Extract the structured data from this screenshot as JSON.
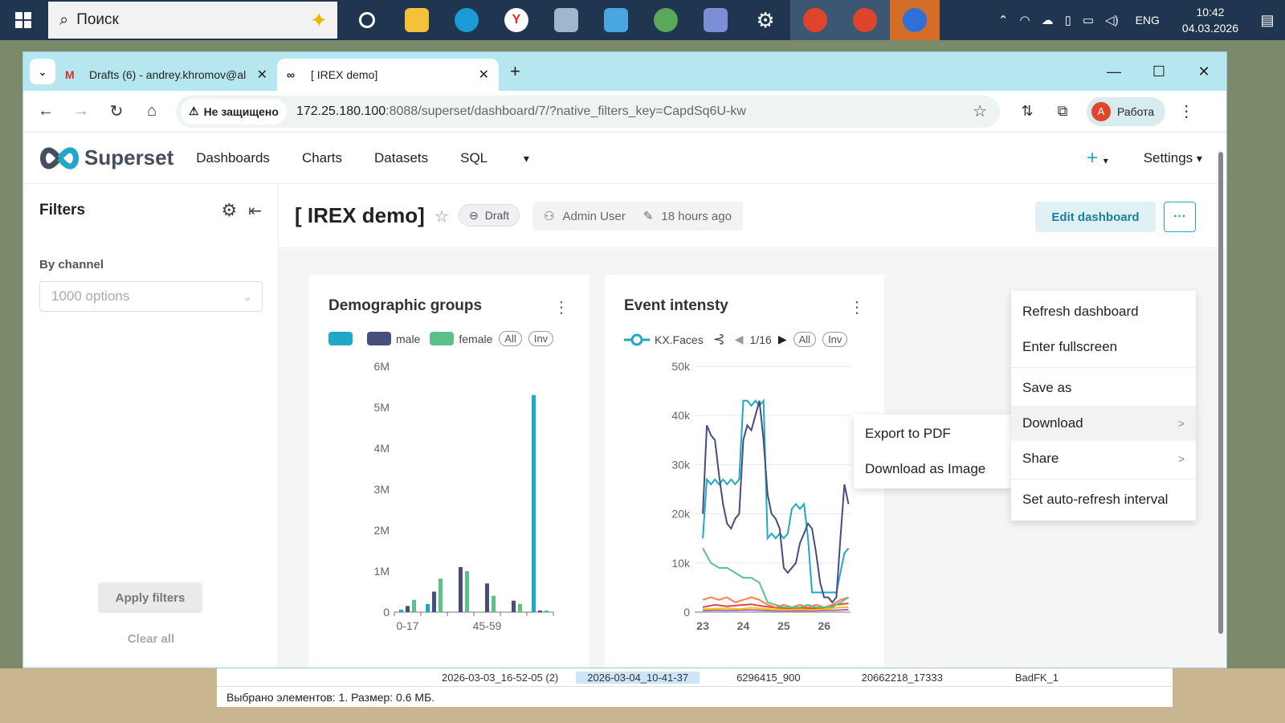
{
  "taskbar": {
    "search_placeholder": "Поиск",
    "lang": "ENG",
    "time": "10:42",
    "date": "04.03.2026"
  },
  "explorer": {
    "row_cells": [
      "2026-03-03_16-52-05 (2)",
      "2026-03-04_10-41-37",
      "6296415_900",
      "20662218_17333",
      "BadFK_1"
    ],
    "status": "Выбрано элементов: 1. Размер: 0.6 МБ."
  },
  "browser": {
    "tabs": [
      {
        "title": "Drafts (6) - andrey.khromov@al"
      },
      {
        "title": "[ IREX demo]"
      }
    ],
    "security_label": "Не защищено",
    "url_host": "172.25.180.100",
    "url_rest": ":8088/superset/dashboard/7/?native_filters_key=CapdSq6U-kw",
    "profile_initial": "А",
    "profile_label": "Работа"
  },
  "superset": {
    "brand": "Superset",
    "nav": [
      "Dashboards",
      "Charts",
      "Datasets",
      "SQL"
    ],
    "settings_label": "Settings"
  },
  "sidebar": {
    "title": "Filters",
    "filter_label": "By channel",
    "select_placeholder": "1000 options",
    "apply_label": "Apply filters",
    "clear_label": "Clear all"
  },
  "dashboard": {
    "title": "[ IREX demo]",
    "status": "Draft",
    "owner": "Admin User",
    "modified": "18 hours ago",
    "edit_label": "Edit dashboard",
    "more_label": "···"
  },
  "menu": {
    "items": [
      "Refresh dashboard",
      "Enter fullscreen",
      "Save as",
      "Download",
      "Share",
      "Set auto-refresh interval"
    ],
    "submenu": [
      "Export to PDF",
      "Download as Image"
    ]
  },
  "chart_data": [
    {
      "type": "bar",
      "title": "Demographic groups",
      "legend_items": [
        "male",
        "female"
      ],
      "legend_controls": [
        "All",
        "Inv"
      ],
      "tick_labels_x": [
        "0-17",
        "45-59"
      ],
      "ylim": [
        0,
        6000000
      ],
      "ytick_labels": [
        "0",
        "1M",
        "2M",
        "3M",
        "4M",
        "5M",
        "6M"
      ],
      "ytick_values": [
        0,
        1000000,
        2000000,
        3000000,
        4000000,
        5000000,
        6000000
      ],
      "group_count": 6,
      "series": [
        {
          "name": "",
          "color": "#1fa8c9",
          "values": [
            60000,
            200000,
            0,
            0,
            0,
            5300000
          ]
        },
        {
          "name": "male",
          "color": "#454e7c",
          "values": [
            150000,
            500000,
            1100000,
            700000,
            280000,
            40000
          ]
        },
        {
          "name": "female",
          "color": "#5ac189",
          "values": [
            300000,
            820000,
            1000000,
            400000,
            200000,
            40000
          ]
        }
      ]
    },
    {
      "type": "line",
      "title": "Event intensty",
      "legend_series": "KX.Faces",
      "legend_page": "1/16",
      "legend_controls": [
        "All",
        "Inv"
      ],
      "xlim": [
        22.8,
        26.65
      ],
      "ylim": [
        0,
        50000
      ],
      "xtick_labels": [
        "23",
        "24",
        "25",
        "26"
      ],
      "xtick_values": [
        23,
        24,
        25,
        26
      ],
      "ytick_labels": [
        "0",
        "10k",
        "20k",
        "30k",
        "40k",
        "50k"
      ],
      "ytick_values": [
        0,
        10000,
        20000,
        30000,
        40000,
        50000
      ],
      "series": [
        {
          "name": "",
          "color": "#454e7c",
          "x": [
            23.0,
            23.1,
            23.2,
            23.3,
            23.4,
            23.5,
            23.6,
            23.7,
            23.8,
            23.9,
            24.0,
            24.1,
            24.2,
            24.3,
            24.4,
            24.5,
            24.6,
            24.7,
            24.8,
            24.9,
            25.0,
            25.1,
            25.2,
            25.3,
            25.4,
            25.5,
            25.6,
            25.7,
            25.8,
            25.9,
            26.0,
            26.1,
            26.2,
            26.3,
            26.4,
            26.5,
            26.6
          ],
          "y": [
            20000,
            38000,
            36000,
            35000,
            28000,
            22000,
            18000,
            17000,
            19000,
            20000,
            35000,
            38000,
            37000,
            40000,
            43000,
            35000,
            24000,
            20000,
            19000,
            17000,
            9000,
            8000,
            9000,
            10000,
            14000,
            16000,
            18000,
            17000,
            12000,
            6000,
            3000,
            3000,
            2000,
            3000,
            15000,
            26000,
            22000
          ]
        },
        {
          "name": "",
          "color": "#1fa8c9",
          "x": [
            23.0,
            23.1,
            23.2,
            23.3,
            23.4,
            23.5,
            23.6,
            23.7,
            23.8,
            23.9,
            24.0,
            24.1,
            24.2,
            24.3,
            24.4,
            24.5,
            24.6,
            24.7,
            24.8,
            24.9,
            25.0,
            25.1,
            25.2,
            25.3,
            25.4,
            25.5,
            25.6,
            25.7,
            25.8,
            25.9,
            26.0,
            26.1,
            26.2,
            26.3,
            26.4,
            26.5,
            26.6
          ],
          "y": [
            15000,
            27000,
            26000,
            27000,
            26000,
            27000,
            26000,
            27000,
            26000,
            27000,
            43000,
            43000,
            42000,
            43000,
            42000,
            43000,
            15000,
            16000,
            15000,
            16000,
            15000,
            16000,
            21000,
            22000,
            21000,
            22000,
            15000,
            4000,
            4000,
            4000,
            4000,
            4000,
            4000,
            4000,
            8000,
            12000,
            13000
          ]
        },
        {
          "name": "",
          "color": "#5ac189",
          "x": [
            23.0,
            23.2,
            23.4,
            23.6,
            23.8,
            24.0,
            24.2,
            24.4,
            24.6,
            24.8,
            25.0,
            25.2,
            25.4,
            25.6,
            25.8,
            26.0,
            26.2,
            26.4,
            26.6
          ],
          "y": [
            13000,
            10000,
            9000,
            9000,
            8000,
            7000,
            7000,
            6000,
            2000,
            1500,
            1000,
            1000,
            1000,
            1500,
            1000,
            1000,
            1000,
            2000,
            3000
          ]
        },
        {
          "name": "",
          "color": "#ff7f44",
          "x": [
            23.0,
            23.2,
            23.4,
            23.6,
            23.8,
            24.0,
            24.2,
            24.4,
            24.6,
            24.8,
            25.0,
            25.2,
            25.4,
            25.6,
            25.8,
            26.0,
            26.2,
            26.4,
            26.6
          ],
          "y": [
            2500,
            3000,
            2500,
            3000,
            2000,
            2500,
            3000,
            2500,
            1500,
            1000,
            1500,
            1000,
            1500,
            1000,
            1500,
            1000,
            1500,
            2500,
            3000
          ]
        },
        {
          "name": "",
          "color": "#e04355",
          "x": [
            23.0,
            23.3,
            23.6,
            23.9,
            24.2,
            24.5,
            24.8,
            25.1,
            25.4,
            25.7,
            26.0,
            26.3,
            26.6
          ],
          "y": [
            1000,
            1500,
            1200,
            1400,
            1600,
            1200,
            900,
            800,
            900,
            800,
            900,
            1500,
            1800
          ]
        },
        {
          "name": "",
          "color": "#fcc700",
          "x": [
            23.0,
            23.3,
            23.6,
            23.9,
            24.2,
            24.5,
            24.8,
            25.1,
            25.4,
            25.7,
            26.0,
            26.3,
            26.6
          ],
          "y": [
            600,
            700,
            800,
            600,
            900,
            700,
            500,
            500,
            600,
            500,
            600,
            900,
            1000
          ]
        },
        {
          "name": "",
          "color": "#a868b7",
          "x": [
            23.0,
            23.3,
            23.6,
            23.9,
            24.2,
            24.5,
            24.8,
            25.1,
            25.4,
            25.7,
            26.0,
            26.3,
            26.6
          ],
          "y": [
            300,
            400,
            350,
            400,
            450,
            350,
            300,
            300,
            300,
            300,
            350,
            400,
            500
          ]
        }
      ]
    }
  ]
}
